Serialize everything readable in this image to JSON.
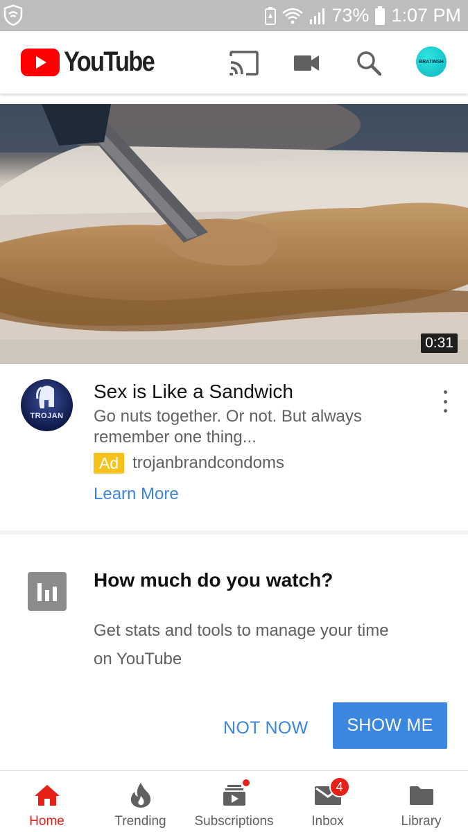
{
  "status_bar": {
    "battery_percent": "73%",
    "time": "1:07 PM",
    "icons": [
      "shield-icon",
      "battery-saver-icon",
      "wifi-icon",
      "signal-icon",
      "battery-icon"
    ]
  },
  "app_bar": {
    "logo_text": "YouTube",
    "brand_color": "#ff0000",
    "icons": [
      "cast-icon",
      "video-camera-icon",
      "search-icon"
    ],
    "avatar_text": "BRATINSH"
  },
  "video": {
    "duration": "0:31"
  },
  "ad": {
    "title": "Sex is Like a Sandwich",
    "description": "Go nuts together. Or not. But always remember one thing...",
    "badge": "Ad",
    "channel": "trojanbrandcondoms",
    "cta": "Learn More",
    "avatar_text": "TROJAN"
  },
  "stats_prompt": {
    "title": "How much do you watch?",
    "description": "Get stats and tools to manage your time on YouTube",
    "not_now": "NOT NOW",
    "show_me": "SHOW ME"
  },
  "bottom_nav": {
    "items": [
      {
        "label": "Home",
        "icon": "home-icon",
        "active": true
      },
      {
        "label": "Trending",
        "icon": "flame-icon"
      },
      {
        "label": "Subscriptions",
        "icon": "subscriptions-icon"
      },
      {
        "label": "Inbox",
        "icon": "mail-icon",
        "badge": "4"
      },
      {
        "label": "Library",
        "icon": "folder-icon"
      }
    ]
  },
  "colors": {
    "accent_red": "#e62117",
    "link_blue": "#3b86e0",
    "ad_badge_yellow": "#f7c11c"
  }
}
